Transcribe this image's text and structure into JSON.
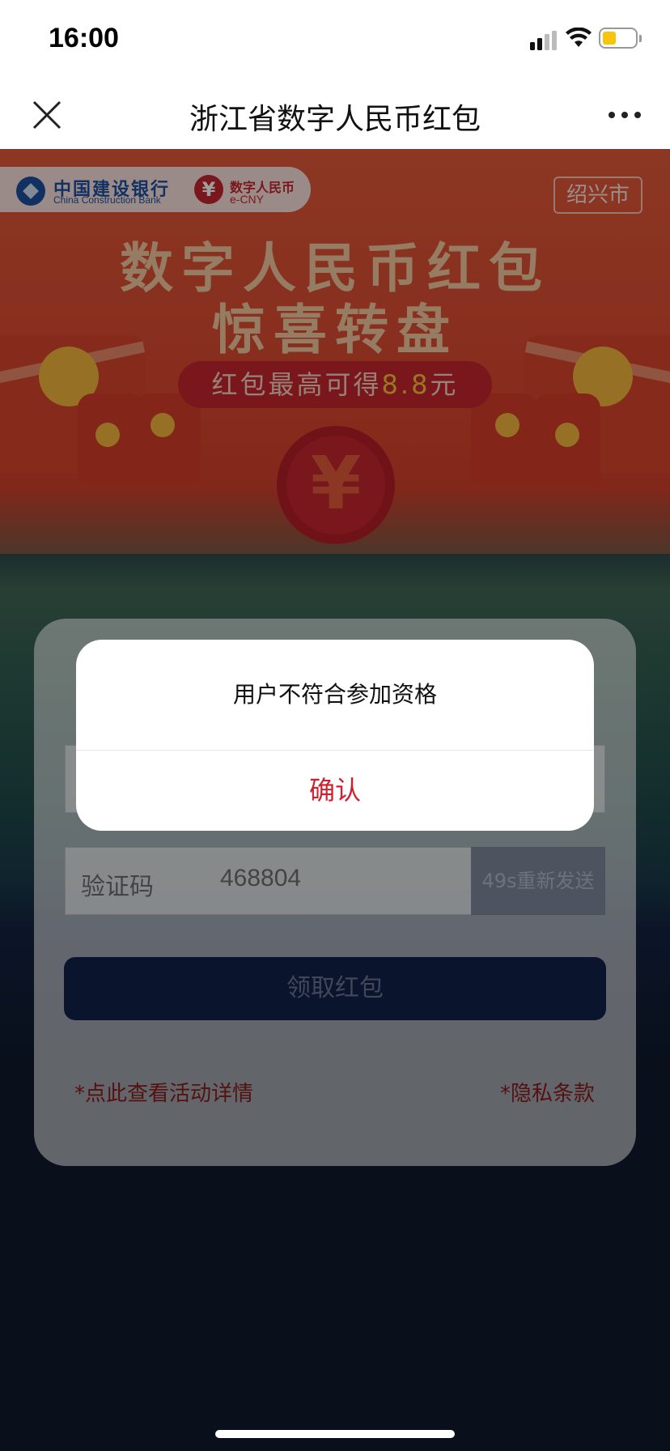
{
  "status_bar": {
    "time": "16:00"
  },
  "navbar": {
    "title": "浙江省数字人民币红包"
  },
  "hero": {
    "bank_name_cn": "中国建设银行",
    "bank_name_en": "China Construction Bank",
    "ecny_cn": "数字人民币",
    "ecny_en": "e-CNY",
    "city": "绍兴市",
    "title_line1": "数字人民币红包",
    "title_line2": "惊喜转盘",
    "promo_prefix": "红包最高可得",
    "promo_amount": "8.8",
    "promo_suffix": "元",
    "coin_symbol": "¥"
  },
  "form": {
    "code_label": "验证码",
    "code_value": "468804",
    "resend_label": "49s重新发送",
    "claim_label": "领取红包",
    "details_link": "*点此查看活动详情",
    "privacy_link": "*隐私条款"
  },
  "dialog": {
    "message": "用户不符合参加资格",
    "confirm_label": "确认"
  },
  "colors": {
    "accent_red": "#d0202e",
    "navy": "#13214a",
    "hero_red": "#e25a3a"
  }
}
